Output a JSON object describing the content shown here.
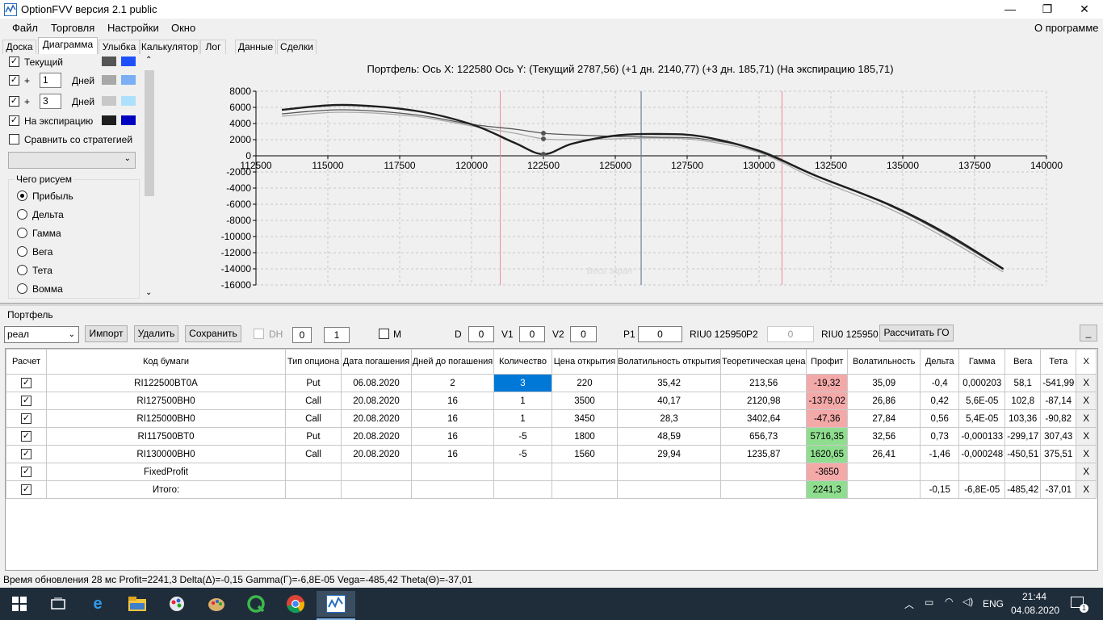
{
  "window": {
    "title": "OptionFVV версия 2.1 public",
    "minimize": "—",
    "maximize": "❐",
    "close": "✕"
  },
  "menu": {
    "items": [
      "Файл",
      "Торговля",
      "Настройки",
      "Окно"
    ],
    "about": "О программе"
  },
  "tabs": [
    "Доска",
    "Диаграмма",
    "Улыбка",
    "Калькулятор",
    "Лог",
    "Данные",
    "Сделки"
  ],
  "left": {
    "current_label": "Текущий",
    "plus": "+",
    "days1": "1",
    "days2": "3",
    "days_label": "Дней",
    "expiry_label": "На экспирацию",
    "compare_label": "Сравнить со стратегией",
    "group_title": "Чего рисуем",
    "radios": [
      "Прибыль",
      "Дельта",
      "Гамма",
      "Вега",
      "Тета",
      "Вомма"
    ],
    "colors": {
      "current": [
        "#555555",
        "#1e50ff"
      ],
      "d1": [
        "#a8a8a8",
        "#7aaef5"
      ],
      "d3": [
        "#c8c8c8",
        "#ade1fb"
      ],
      "exp": [
        "#1e1e1e",
        "#0000c0"
      ]
    }
  },
  "chart_data": {
    "type": "line",
    "title": "Портфель:  Ось X:  122580  Ось Y:   (Текущий 2787,56)   (+1 дн. 2140,77)   (+3 дн. 185,71)   (На экспирацию 185,71)",
    "watermark": "Весь экран",
    "xlim": [
      112500,
      140000
    ],
    "ylim": [
      -16000,
      8000
    ],
    "xticks": [
      "112500",
      "115000",
      "117500",
      "120000",
      "122500",
      "125000",
      "127500",
      "130000",
      "132500",
      "135000",
      "137500",
      "140000"
    ],
    "yticks": [
      "8000",
      "6000",
      "4000",
      "2000",
      "0",
      "-2000",
      "-4000",
      "-6000",
      "-8000",
      "-10000",
      "-12000",
      "-14000",
      "-16000"
    ],
    "vlines": {
      "red": [
        121000,
        130800
      ],
      "blue": 125900
    },
    "series": [
      {
        "color": "#1e1e1e",
        "x": [
          113400,
          115500,
          118000,
          120000,
          121500,
          122500,
          123500,
          125000,
          126500,
          128000,
          130000,
          132000,
          134500,
          136500,
          138500
        ],
        "y": [
          5700,
          6300,
          5600,
          3900,
          1600,
          200,
          1500,
          2500,
          2700,
          2400,
          600,
          -2500,
          -6000,
          -9600,
          -14000
        ]
      },
      {
        "color": "#555555",
        "x": [
          113400,
          115500,
          118000,
          120000,
          121500,
          122500,
          123500,
          125000,
          126500,
          128000,
          130000,
          132000,
          134500,
          136500,
          138500
        ],
        "y": [
          5200,
          5700,
          5100,
          3900,
          3300,
          2800,
          2600,
          2400,
          2300,
          2100,
          700,
          -2500,
          -6100,
          -9800,
          -14100
        ]
      },
      {
        "color": "#a8a8a8",
        "x": [
          113400,
          115500,
          118000,
          120000,
          121500,
          122500,
          123500,
          125000,
          126500,
          128000,
          130000,
          132000,
          134500,
          136500,
          138500
        ],
        "y": [
          4900,
          5400,
          4900,
          3700,
          2800,
          2100,
          2000,
          2100,
          2200,
          1900,
          400,
          -2900,
          -6500,
          -10200,
          -14400
        ]
      }
    ],
    "markers": [
      {
        "x": 122500,
        "y": 2800
      },
      {
        "x": 122500,
        "y": 200
      },
      {
        "x": 122500,
        "y": 2100
      }
    ]
  },
  "portfolio": {
    "title": "Портфель",
    "select": "реал",
    "import": "Импорт",
    "delete": "Удалить",
    "save": "Сохранить",
    "dh": "DH",
    "spin1": "0",
    "spin2": "1",
    "m": "M",
    "d_label": "D",
    "d_val": "0",
    "v1_label": "V1",
    "v1_val": "0",
    "v2_label": "V2",
    "v2_val": "0",
    "p1_label": "P1",
    "p1_val": "0",
    "riu1": "RIU0 125950",
    "p2_label": "P2",
    "p2_val": "0",
    "riu2": "RIU0 125950",
    "calc_go": "Рассчитать ГО",
    "underscore": "_"
  },
  "table": {
    "headers": [
      "Расчет",
      "Код бумаги",
      "Тип опциона",
      "Дата погашения",
      "Дней до погашения",
      "Количество",
      "Цена открытия",
      "Волатильность открытия",
      "Теоретическая цена",
      "Профит",
      "Волатильность",
      "Дельта",
      "Гамма",
      "Вега",
      "Тета",
      "X"
    ],
    "rows": [
      [
        "✓",
        "RI122500BT0A",
        "Put",
        "06.08.2020",
        "2",
        "3",
        "220",
        "35,42",
        "213,56",
        "-19,32",
        "35,09",
        "-0,4",
        "0,000203",
        "58,1",
        "-541,99",
        "X"
      ],
      [
        "✓",
        "RI127500BH0",
        "Call",
        "20.08.2020",
        "16",
        "1",
        "3500",
        "40,17",
        "2120,98",
        "-1379,02",
        "26,86",
        "0,42",
        "5,6E-05",
        "102,8",
        "-87,14",
        "X"
      ],
      [
        "✓",
        "RI125000BH0",
        "Call",
        "20.08.2020",
        "16",
        "1",
        "3450",
        "28,3",
        "3402,64",
        "-47,36",
        "27,84",
        "0,56",
        "5,4E-05",
        "103,36",
        "-90,82",
        "X"
      ],
      [
        "✓",
        "RI117500BT0",
        "Put",
        "20.08.2020",
        "16",
        "-5",
        "1800",
        "48,59",
        "656,73",
        "5716,35",
        "32,56",
        "0,73",
        "-0,000133",
        "-299,17",
        "307,43",
        "X"
      ],
      [
        "✓",
        "RI130000BH0",
        "Call",
        "20.08.2020",
        "16",
        "-5",
        "1560",
        "29,94",
        "1235,87",
        "1620,65",
        "26,41",
        "-1,46",
        "-0,000248",
        "-450,51",
        "375,51",
        "X"
      ],
      [
        "✓",
        "FixedProfit",
        "",
        "",
        "",
        "",
        "",
        "",
        "",
        "-3650",
        "",
        "",
        "",
        "",
        "",
        "X"
      ],
      [
        "✓",
        "Итого:",
        "",
        "",
        "",
        "",
        "",
        "",
        "",
        "2241,3",
        "",
        "-0,15",
        "-6,8E-05",
        "-485,42",
        "-37,01",
        "X"
      ]
    ],
    "profit_colors": {
      "neg": "#f4a9a9",
      "pos": "#8fde8f"
    }
  },
  "status": "Время обновления 28 мс   Profit=2241,3 Delta(Δ)=-0,15 Gamma(Γ)=-6,8E-05 Vega=-485,42 Theta(Θ)=-37,01",
  "taskbar": {
    "lang": "ENG",
    "time": "21:44",
    "date": "04.08.2020",
    "notif": "1"
  }
}
